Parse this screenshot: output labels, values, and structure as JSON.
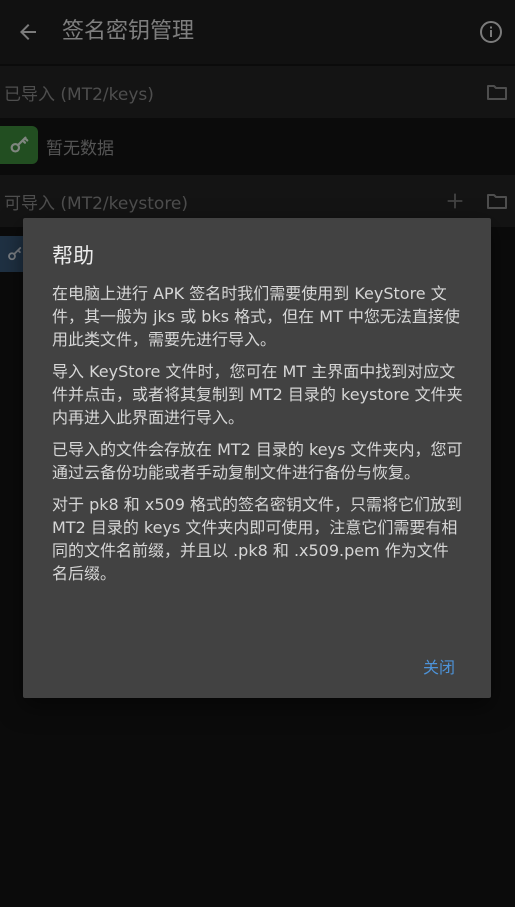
{
  "appbar": {
    "title": "签名密钥管理",
    "back_icon": "arrow-left-icon",
    "info_icon": "info-circle-icon"
  },
  "sections": [
    {
      "label": "已导入 (MT2/keys)",
      "actions": [
        "folder-icon"
      ]
    },
    {
      "label": "可导入 (MT2/keystore)",
      "actions": [
        "plus-icon",
        "folder-icon"
      ]
    }
  ],
  "imported_list": {
    "empty_text": "暂无数据",
    "icon": "key-icon"
  },
  "dialog": {
    "title": "帮助",
    "paragraphs": [
      "在电脑上进行 APK 签名时我们需要使用到 KeyStore 文件，其一般为 jks 或 bks 格式，但在 MT 中您无法直接使用此类文件，需要先进行导入。",
      "导入 KeyStore 文件时，您可在 MT 主界面中找到对应文件并点击，或者将其复制到 MT2 目录的 keystore 文件夹内再进入此界面进行导入。",
      "已导入的文件会存放在 MT2 目录的 keys 文件夹内，您可通过云备份功能或者手动复制文件进行备份与恢复。",
      "对于 pk8 和 x509 格式的签名密钥文件，只需将它们放到 MT2 目录的 keys 文件夹内即可使用，注意它们需要有相同的文件名前缀，并且以 .pk8 和 .x509.pem 作为文件名后缀。"
    ],
    "close_label": "关闭"
  },
  "colors": {
    "accent": "#4d93d9",
    "key_badge": "#3e8e3c",
    "dialog_bg": "#424242"
  }
}
